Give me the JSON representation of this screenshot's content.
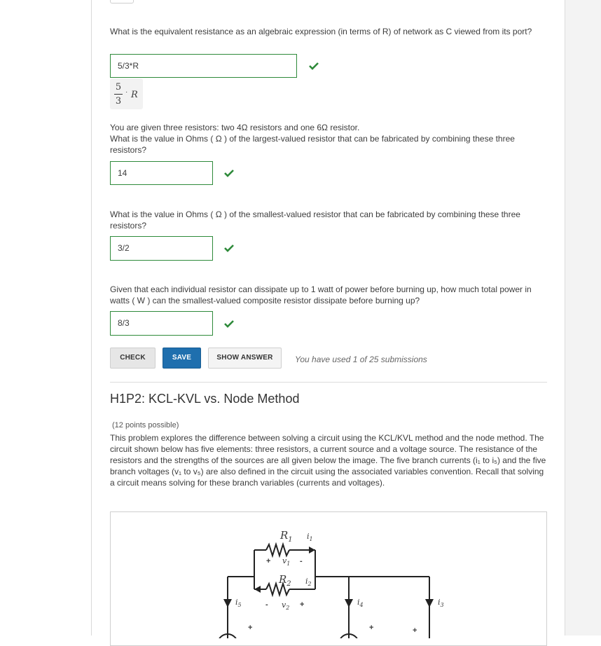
{
  "q1": {
    "text": "What is the equivalent resistance as an algebraic expression (in terms of R) of network as C viewed from its port?",
    "answer": "5/3*R",
    "preview": {
      "num": "5",
      "den": "3",
      "var": "R"
    }
  },
  "q2": {
    "intro": "You are given three resistors: two 4Ω resistors and one 6Ω resistor.",
    "text": "What is the value in Ohms ( Ω ) of the largest-valued resistor that can be fabricated by combining these three resistors?",
    "answer": "14"
  },
  "q3": {
    "text": "What is the value in Ohms ( Ω ) of the smallest-valued resistor that can be fabricated by combining these three resistors?",
    "answer": "3/2"
  },
  "q4": {
    "text": "Given that each individual resistor can dissipate up to 1 watt of power before burning up, how much total power in watts ( W ) can the smallest-valued composite resistor dissipate before burning up?",
    "answer": "8/3"
  },
  "actions": {
    "check": "CHECK",
    "save": "SAVE",
    "show_answer": "SHOW ANSWER",
    "submissions": "You have used 1 of 25 submissions"
  },
  "problem2": {
    "title": "H1P2: KCL-KVL vs. Node Method",
    "points": "(12 points possible)",
    "description": "This problem explores the difference between solving a circuit using the KCL/KVL method and the node method. The circuit shown below has five elements: three resistors, a current source and a voltage source. The resistance of the resistors and the strengths of the sources are all given below the image. The five branch currents (i₁ to i₅) and the five branch voltages (v₁ to v₅) are also defined in the circuit using the associated variables convention. Recall that solving a circuit means solving for these branch variables (currents and voltages)."
  },
  "circuit": {
    "r1": "R",
    "r1_sub": "1",
    "r2": "R",
    "r2_sub": "2",
    "i1": "i",
    "i1_sub": "1",
    "i2": "i",
    "i2_sub": "2",
    "v1": "v",
    "v1_sub": "1",
    "v2": "v",
    "v2_sub": "2",
    "i3": "i",
    "i3_sub": "3",
    "i4": "i",
    "i4_sub": "4",
    "i5": "i",
    "i5_sub": "5",
    "plus": "+",
    "minus": "-"
  },
  "colors": {
    "correct": "#2e8a3a",
    "save_blue": "#1f6fae"
  }
}
